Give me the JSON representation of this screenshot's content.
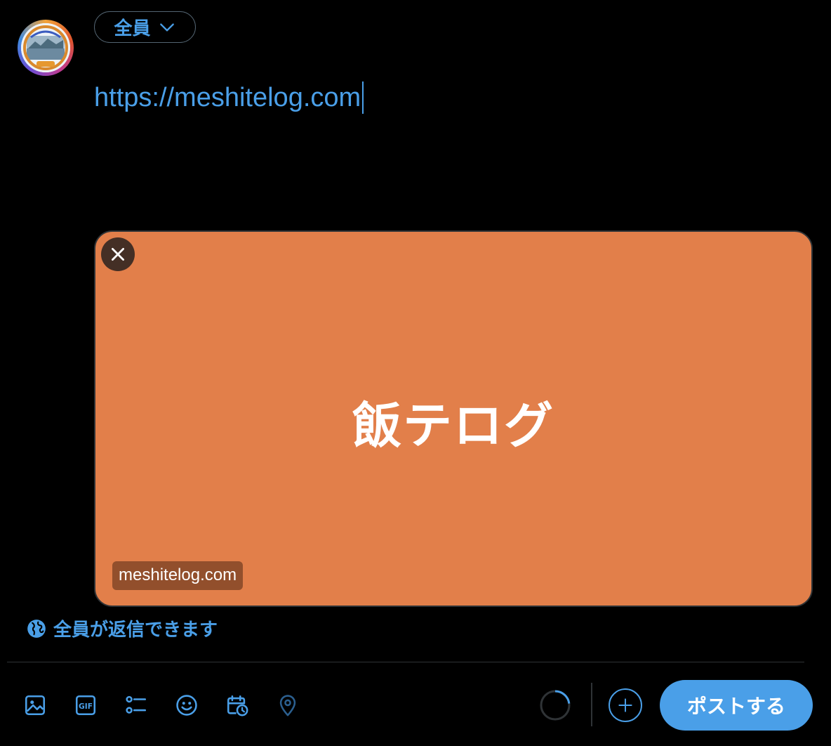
{
  "composer": {
    "audience_label": "全員",
    "text": "https://meshitelog.com",
    "avatar_icon": "community-avatar-icon"
  },
  "link_card": {
    "title": "飯テログ",
    "domain": "meshitelog.com",
    "background_color": "#e27f4a",
    "close_icon": "close-icon"
  },
  "reply_setting": {
    "label": "全員が返信できます",
    "icon": "globe-icon"
  },
  "toolbar": {
    "icons": [
      "image-icon",
      "gif-icon",
      "poll-icon",
      "emoji-icon",
      "schedule-icon",
      "location-icon"
    ],
    "char_progress": 0.23,
    "post_label": "ポストする"
  },
  "colors": {
    "accent": "#4a9fe8",
    "background": "#000000",
    "border": "#2f3336"
  }
}
